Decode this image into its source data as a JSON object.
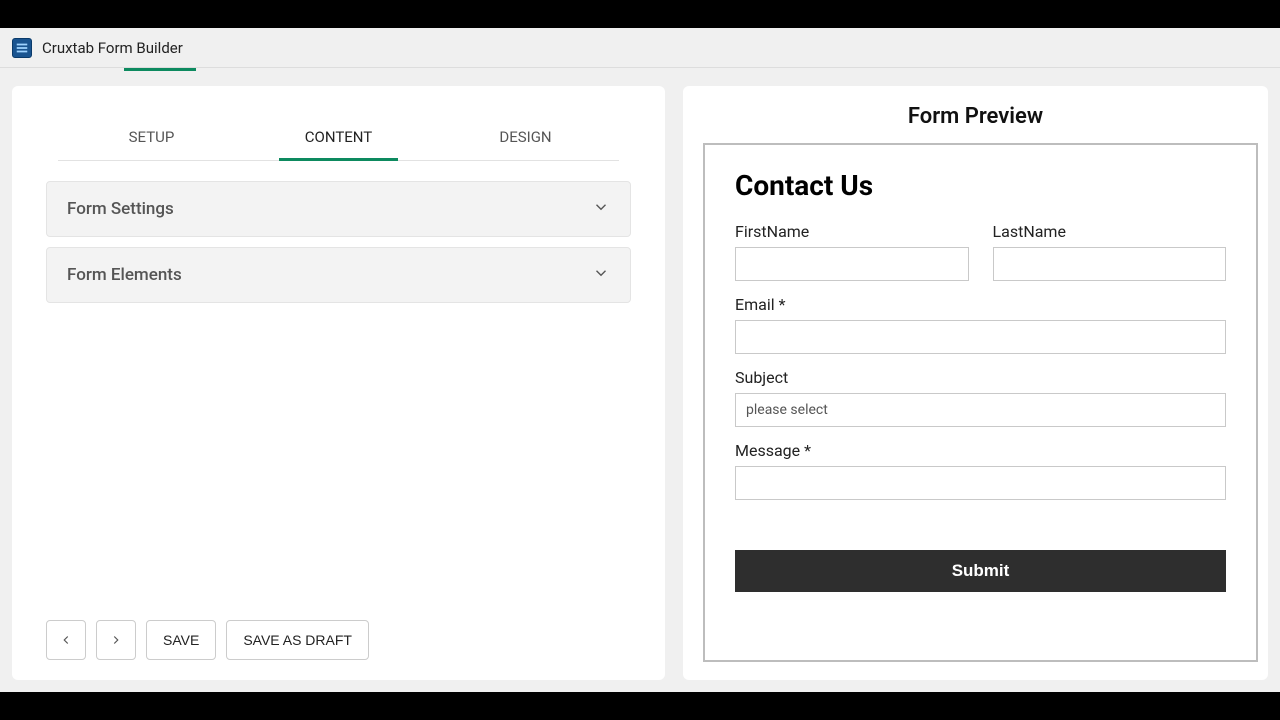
{
  "app": {
    "title": "Cruxtab Form Builder"
  },
  "left": {
    "tabs": [
      {
        "label": "SETUP",
        "active": false
      },
      {
        "label": "CONTENT",
        "active": true
      },
      {
        "label": "DESIGN",
        "active": false
      }
    ],
    "accordions": [
      {
        "title": "Form Settings"
      },
      {
        "title": "Form Elements"
      }
    ],
    "buttons": {
      "save": "SAVE",
      "save_draft": "SAVE AS DRAFT"
    }
  },
  "preview": {
    "heading": "Form Preview",
    "form_title": "Contact Us",
    "fields": {
      "first_name": {
        "label": "FirstName"
      },
      "last_name": {
        "label": "LastName"
      },
      "email": {
        "label": "Email *"
      },
      "subject": {
        "label": "Subject",
        "placeholder": "please select"
      },
      "message": {
        "label": "Message *"
      }
    },
    "submit_label": "Submit"
  }
}
